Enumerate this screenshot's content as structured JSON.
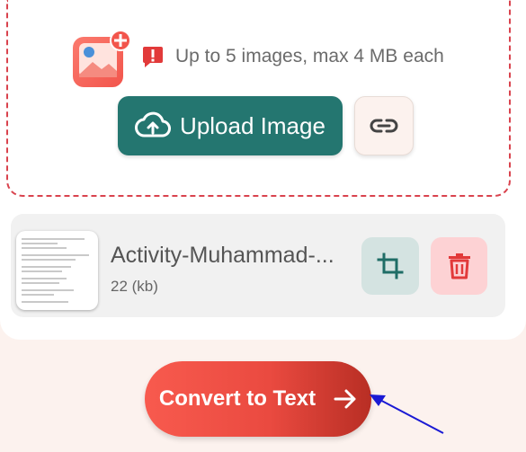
{
  "upload": {
    "limit_text": "Up to 5 images, max 4 MB each",
    "upload_label": "Upload Image",
    "icons": {
      "image": "image-add-icon",
      "warning": "warning-icon",
      "upload": "cloud-upload-icon",
      "link": "link-icon"
    }
  },
  "file": {
    "name": "Activity-Muhammad-...",
    "size": "22 (kb)",
    "icons": {
      "crop": "crop-icon",
      "delete": "trash-icon"
    }
  },
  "convert": {
    "label": "Convert to Text",
    "icon": "arrow-right-icon"
  },
  "colors": {
    "primary_teal": "#247670",
    "accent_red": "#ea4a40",
    "dashed_border": "#d9434e",
    "page_bg": "#fcf2ee",
    "annotation_arrow": "#1a1ad4"
  }
}
